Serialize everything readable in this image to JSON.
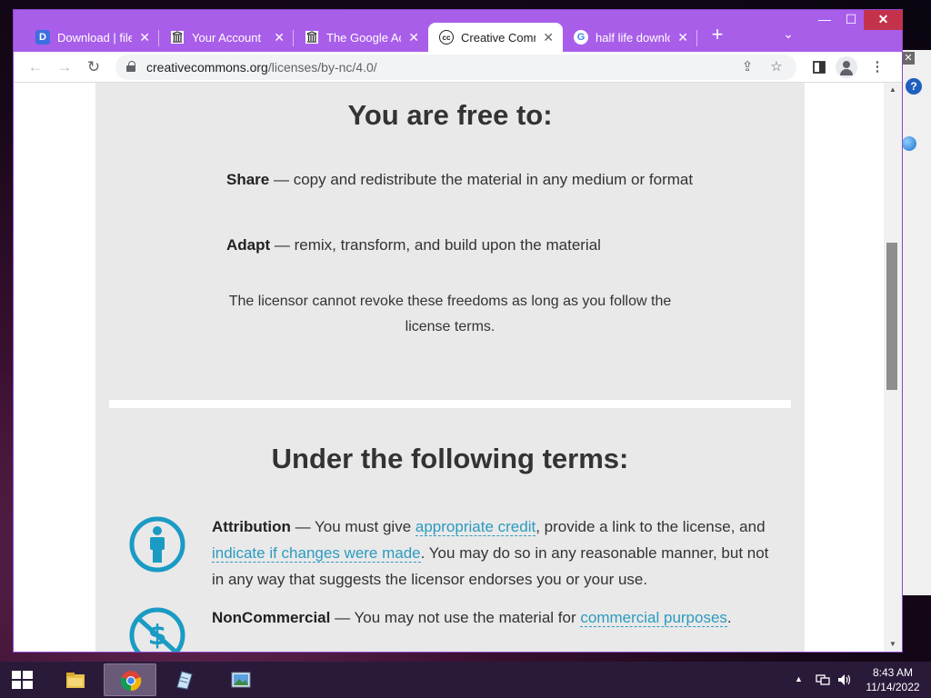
{
  "browser": {
    "tabs": [
      {
        "title": "Download | file.",
        "favicon": "D",
        "active": false
      },
      {
        "title": "Your Account",
        "favicon": "library-icon",
        "active": false
      },
      {
        "title": "The Google Acc",
        "favicon": "library-icon",
        "active": false
      },
      {
        "title": "Creative Comm",
        "favicon": "cc",
        "active": true
      },
      {
        "title": "half life downlo",
        "favicon": "G",
        "active": false
      }
    ],
    "new_tab": "+",
    "tab_menu": "⌄",
    "controls": {
      "minimize": "—",
      "maximize": "☐",
      "close": "✕"
    },
    "url_host": "creativecommons.org",
    "url_path": "/licenses/by-nc/4.0/"
  },
  "page": {
    "free_heading": "You are free to:",
    "share_term": "Share",
    "share_text": " — copy and redistribute the material in any medium or format",
    "adapt_term": "Adapt",
    "adapt_text": " — remix, transform, and build upon the material",
    "licensor_note": "The licensor cannot revoke these freedoms as long as you follow the license terms.",
    "terms_heading": "Under the following terms:",
    "attribution": {
      "term": "Attribution",
      "t1": " — You must give ",
      "link1": "appropriate credit",
      "t2": ", provide a link to the license, and ",
      "link2": "indicate if changes were made",
      "t3": ". You may do so in any reasonable manner, but not in any way that suggests the licensor endorses you or your use."
    },
    "noncommercial": {
      "term": "NonCommercial",
      "t1": " — You may not use the material for ",
      "link1": "commercial purposes",
      "t2": "."
    },
    "accent_color": "#2b9bbf",
    "icon_color": "#1a9bc4"
  },
  "taskbar": {
    "apps": [
      "file-explorer-icon",
      "chrome-icon",
      "notepad-icon",
      "photo-viewer-icon"
    ],
    "time": "8:43 AM",
    "date": "11/14/2022"
  }
}
